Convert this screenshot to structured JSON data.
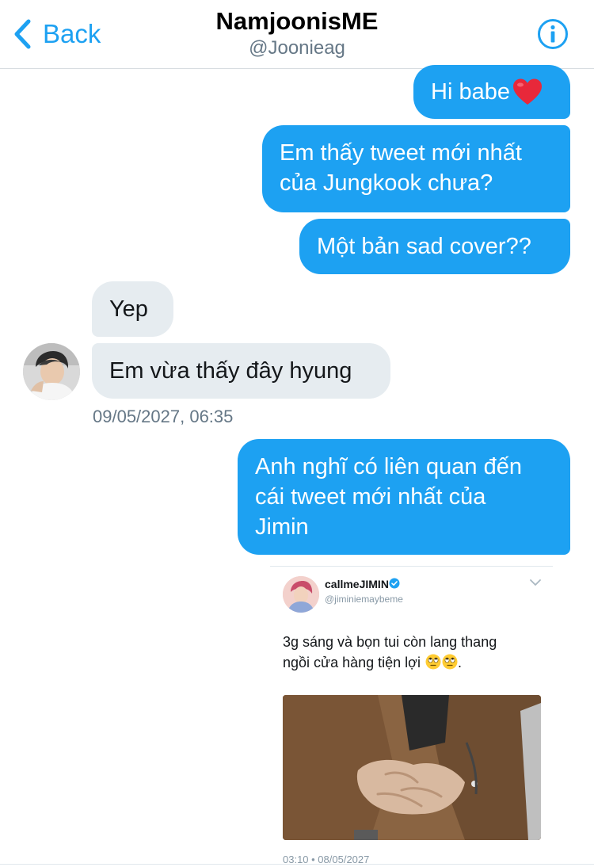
{
  "header": {
    "back_label": "Back",
    "title": "NamjoonisME",
    "handle": "@Joonieag"
  },
  "messages": [
    {
      "direction": "out",
      "text": "Hi babe",
      "emoji": "heart"
    },
    {
      "direction": "out",
      "lines": [
        "Em thấy tweet mới nhất",
        "của Jungkook chưa?"
      ]
    },
    {
      "direction": "out",
      "text": "Một bản sad cover??"
    },
    {
      "direction": "in",
      "text": "Yep"
    },
    {
      "direction": "in",
      "text": "Em vừa thấy đây hyung"
    },
    {
      "direction": "out",
      "lines": [
        "Anh nghĩ có liên quan đến",
        "cái tweet mới nhất của",
        "Jimin"
      ]
    }
  ],
  "timestamp": "09/05/2027, 06:35",
  "embedded_tweet": {
    "name": "callmeJIMIN",
    "handle": "@jiminiemaybeme",
    "text_lines": [
      "3g sáng và bọn tui còn lang thang",
      "ngồi cửa hàng tiện lợi"
    ],
    "text_suffix": ".",
    "emojis": [
      "rolling-eyes",
      "rolling-eyes"
    ],
    "time": "03:10 • 08/05/2027"
  },
  "colors": {
    "accent": "#1da1f2",
    "incoming_bubble": "#e6ecf0",
    "muted_text": "#657786"
  },
  "icons": {
    "back": "chevron-left-icon",
    "info": "info-circle-icon",
    "verified": "verified-badge-icon",
    "chevron": "chevron-down-icon"
  }
}
